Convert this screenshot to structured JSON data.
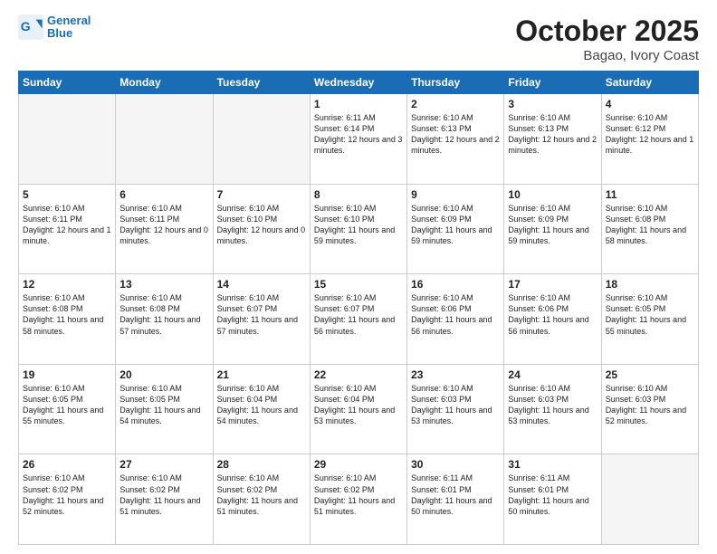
{
  "header": {
    "logo_text": "General Blue",
    "month": "October 2025",
    "location": "Bagao, Ivory Coast"
  },
  "weekdays": [
    "Sunday",
    "Monday",
    "Tuesday",
    "Wednesday",
    "Thursday",
    "Friday",
    "Saturday"
  ],
  "weeks": [
    [
      {
        "day": "",
        "info": ""
      },
      {
        "day": "",
        "info": ""
      },
      {
        "day": "",
        "info": ""
      },
      {
        "day": "1",
        "info": "Sunrise: 6:11 AM\nSunset: 6:14 PM\nDaylight: 12 hours and 3 minutes."
      },
      {
        "day": "2",
        "info": "Sunrise: 6:10 AM\nSunset: 6:13 PM\nDaylight: 12 hours and 2 minutes."
      },
      {
        "day": "3",
        "info": "Sunrise: 6:10 AM\nSunset: 6:13 PM\nDaylight: 12 hours and 2 minutes."
      },
      {
        "day": "4",
        "info": "Sunrise: 6:10 AM\nSunset: 6:12 PM\nDaylight: 12 hours and 1 minute."
      }
    ],
    [
      {
        "day": "5",
        "info": "Sunrise: 6:10 AM\nSunset: 6:11 PM\nDaylight: 12 hours and 1 minute."
      },
      {
        "day": "6",
        "info": "Sunrise: 6:10 AM\nSunset: 6:11 PM\nDaylight: 12 hours and 0 minutes."
      },
      {
        "day": "7",
        "info": "Sunrise: 6:10 AM\nSunset: 6:10 PM\nDaylight: 12 hours and 0 minutes."
      },
      {
        "day": "8",
        "info": "Sunrise: 6:10 AM\nSunset: 6:10 PM\nDaylight: 11 hours and 59 minutes."
      },
      {
        "day": "9",
        "info": "Sunrise: 6:10 AM\nSunset: 6:09 PM\nDaylight: 11 hours and 59 minutes."
      },
      {
        "day": "10",
        "info": "Sunrise: 6:10 AM\nSunset: 6:09 PM\nDaylight: 11 hours and 59 minutes."
      },
      {
        "day": "11",
        "info": "Sunrise: 6:10 AM\nSunset: 6:08 PM\nDaylight: 11 hours and 58 minutes."
      }
    ],
    [
      {
        "day": "12",
        "info": "Sunrise: 6:10 AM\nSunset: 6:08 PM\nDaylight: 11 hours and 58 minutes."
      },
      {
        "day": "13",
        "info": "Sunrise: 6:10 AM\nSunset: 6:08 PM\nDaylight: 11 hours and 57 minutes."
      },
      {
        "day": "14",
        "info": "Sunrise: 6:10 AM\nSunset: 6:07 PM\nDaylight: 11 hours and 57 minutes."
      },
      {
        "day": "15",
        "info": "Sunrise: 6:10 AM\nSunset: 6:07 PM\nDaylight: 11 hours and 56 minutes."
      },
      {
        "day": "16",
        "info": "Sunrise: 6:10 AM\nSunset: 6:06 PM\nDaylight: 11 hours and 56 minutes."
      },
      {
        "day": "17",
        "info": "Sunrise: 6:10 AM\nSunset: 6:06 PM\nDaylight: 11 hours and 56 minutes."
      },
      {
        "day": "18",
        "info": "Sunrise: 6:10 AM\nSunset: 6:05 PM\nDaylight: 11 hours and 55 minutes."
      }
    ],
    [
      {
        "day": "19",
        "info": "Sunrise: 6:10 AM\nSunset: 6:05 PM\nDaylight: 11 hours and 55 minutes."
      },
      {
        "day": "20",
        "info": "Sunrise: 6:10 AM\nSunset: 6:05 PM\nDaylight: 11 hours and 54 minutes."
      },
      {
        "day": "21",
        "info": "Sunrise: 6:10 AM\nSunset: 6:04 PM\nDaylight: 11 hours and 54 minutes."
      },
      {
        "day": "22",
        "info": "Sunrise: 6:10 AM\nSunset: 6:04 PM\nDaylight: 11 hours and 53 minutes."
      },
      {
        "day": "23",
        "info": "Sunrise: 6:10 AM\nSunset: 6:03 PM\nDaylight: 11 hours and 53 minutes."
      },
      {
        "day": "24",
        "info": "Sunrise: 6:10 AM\nSunset: 6:03 PM\nDaylight: 11 hours and 53 minutes."
      },
      {
        "day": "25",
        "info": "Sunrise: 6:10 AM\nSunset: 6:03 PM\nDaylight: 11 hours and 52 minutes."
      }
    ],
    [
      {
        "day": "26",
        "info": "Sunrise: 6:10 AM\nSunset: 6:02 PM\nDaylight: 11 hours and 52 minutes."
      },
      {
        "day": "27",
        "info": "Sunrise: 6:10 AM\nSunset: 6:02 PM\nDaylight: 11 hours and 51 minutes."
      },
      {
        "day": "28",
        "info": "Sunrise: 6:10 AM\nSunset: 6:02 PM\nDaylight: 11 hours and 51 minutes."
      },
      {
        "day": "29",
        "info": "Sunrise: 6:10 AM\nSunset: 6:02 PM\nDaylight: 11 hours and 51 minutes."
      },
      {
        "day": "30",
        "info": "Sunrise: 6:11 AM\nSunset: 6:01 PM\nDaylight: 11 hours and 50 minutes."
      },
      {
        "day": "31",
        "info": "Sunrise: 6:11 AM\nSunset: 6:01 PM\nDaylight: 11 hours and 50 minutes."
      },
      {
        "day": "",
        "info": ""
      }
    ]
  ]
}
